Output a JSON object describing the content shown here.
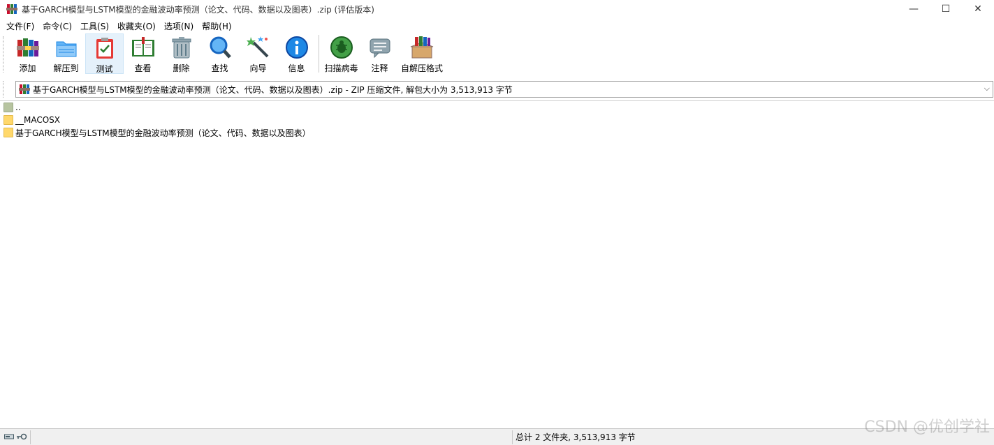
{
  "window": {
    "title": "基于GARCH模型与LSTM模型的金融波动率预测（论文、代码、数据以及图表）.zip (评估版本)",
    "icon": "winrar-icon",
    "controls": [
      "—",
      "☐",
      "✕"
    ]
  },
  "menu": {
    "items": [
      {
        "label": "文件(F)"
      },
      {
        "label": "命令(C)"
      },
      {
        "label": "工具(S)"
      },
      {
        "label": "收藏夹(O)"
      },
      {
        "label": "选项(N)"
      },
      {
        "label": "帮助(H)"
      }
    ]
  },
  "toolbar": {
    "buttons": [
      {
        "label": "添加",
        "icon": "books-stack-icon"
      },
      {
        "label": "解压到",
        "icon": "folder-extract-icon"
      },
      {
        "label": "测试",
        "icon": "clipboard-check-icon",
        "active": true
      },
      {
        "label": "查看",
        "icon": "open-book-icon"
      },
      {
        "label": "删除",
        "icon": "trash-can-icon"
      },
      {
        "label": "查找",
        "icon": "magnifier-icon"
      },
      {
        "label": "向导",
        "icon": "magic-wand-icon"
      },
      {
        "label": "信息",
        "icon": "info-icon"
      },
      {
        "label": "扫描病毒",
        "icon": "virus-scan-icon"
      },
      {
        "label": "注释",
        "icon": "comment-icon"
      },
      {
        "label": "自解压格式",
        "icon": "sfx-box-icon"
      }
    ]
  },
  "address": {
    "text": "基于GARCH模型与LSTM模型的金融波动率预测（论文、代码、数据以及图表）.zip - ZIP 压缩文件, 解包大小为 3,513,913 字节",
    "dropdown": "⌵"
  },
  "files": [
    {
      "name": "..",
      "type": "up"
    },
    {
      "name": "__MACOSX",
      "type": "folder"
    },
    {
      "name": "基于GARCH模型与LSTM模型的金融波动率预测（论文、代码、数据以及图表）",
      "type": "folder"
    }
  ],
  "status": {
    "summary": "总计 2 文件夹, 3,513,913 字节"
  },
  "watermark": "CSDN @优创学社",
  "colors": {
    "active_tool_bg": "#e5f1fb",
    "folder_yellow": "#ffd86b",
    "statusbar_bg": "#f0f0f0"
  }
}
